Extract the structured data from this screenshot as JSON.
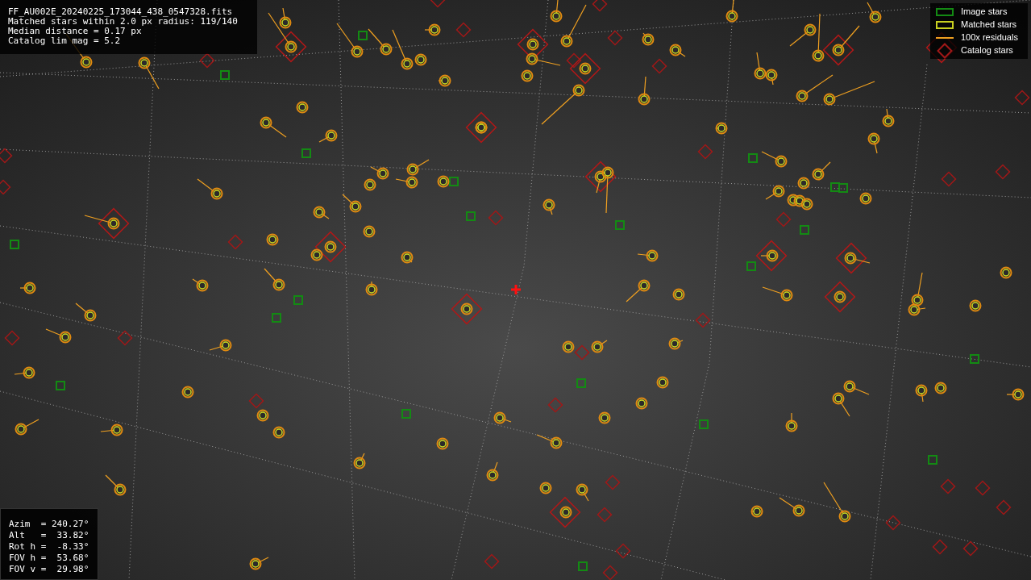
{
  "file_info": {
    "lines": [
      "FF_AU002E_20240225_173044_438_0547328.fits",
      "Matched stars within 2.0 px radius: 119/140",
      "Median distance = 0.17 px",
      "Catalog lim mag = 5.2"
    ]
  },
  "legend": {
    "items": [
      {
        "kind": "image",
        "label": "Image stars"
      },
      {
        "kind": "matched",
        "label": "Matched stars"
      },
      {
        "kind": "residual",
        "label": "100x residuals"
      },
      {
        "kind": "catalog",
        "label": "Catalog stars"
      }
    ]
  },
  "pointing": {
    "lines": [
      "Azim  = 240.27°",
      "Alt   =  33.82°",
      "Rot h =  -8.33°",
      "FOV h =  53.68°",
      "FOV v =  29.98°"
    ]
  }
}
